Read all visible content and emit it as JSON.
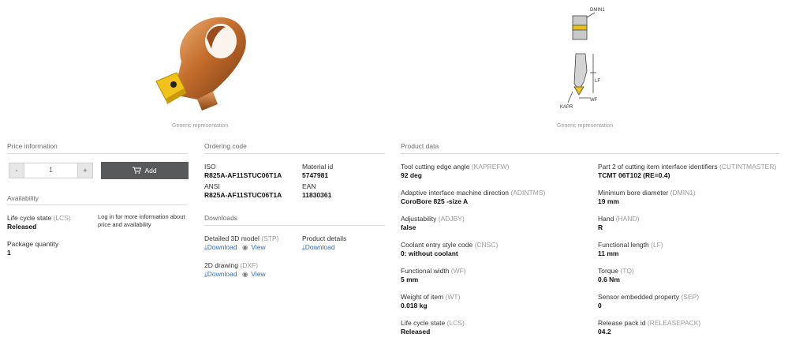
{
  "images": {
    "product_caption": "Generic representation",
    "drawing_caption": "Generic representation",
    "drawing_labels": {
      "dmin": "DMIN1",
      "lf": "LF",
      "wf": "WF",
      "kapr": "KAPR"
    }
  },
  "price": {
    "title": "Price information",
    "minus": "-",
    "quantity": "1",
    "plus": "+",
    "add_label": "Add"
  },
  "availability": {
    "title": "Availability",
    "lcs_label": "Life cycle state",
    "lcs_code": "(LCS)",
    "lcs_value": "Released",
    "login_note": "Log in for more information about price and availability",
    "pkg_label": "Package quantity",
    "pkg_value": "1"
  },
  "ordering": {
    "title": "Ordering code",
    "iso_label": "ISO",
    "iso_value": "R825A-AF11STUC06T1A",
    "ansi_label": "ANSI",
    "ansi_value": "R825A-AF11STUC06T1A",
    "material_label": "Material id",
    "material_value": "5747981",
    "ean_label": "EAN",
    "ean_value": "11830361"
  },
  "downloads": {
    "title": "Downloads",
    "model3d_label": "Detailed 3D model",
    "model3d_code": "(STP)",
    "drawing2d_label": "2D drawing",
    "drawing2d_code": "(DXF)",
    "product_details_label": "Product details",
    "download": "Download",
    "view": "View"
  },
  "product_data": {
    "title": "Product data",
    "left": [
      {
        "label": "Tool cutting edge angle",
        "code": "(KAPREFW)",
        "value": "92 deg"
      },
      {
        "label": "Adaptive interface machine direction",
        "code": "(ADINTMS)",
        "value": "CoroBore 825 -size A"
      },
      {
        "label": "Adjustability",
        "code": "(ADJBY)",
        "value": "false"
      },
      {
        "label": "Coolant entry style code",
        "code": "(CNSC)",
        "value": "0: without coolant"
      },
      {
        "label": "Functional width",
        "code": "(WF)",
        "value": "5 mm"
      },
      {
        "label": "Weight of item",
        "code": "(WT)",
        "value": "0.018 kg"
      },
      {
        "label": "Life cycle state",
        "code": "(LCS)",
        "value": "Released"
      }
    ],
    "right": [
      {
        "label": "Part 2 of cutting item interface identifiers",
        "code": "(CUTINTMASTER)",
        "value": "TCMT 06T102 (RE=0.4)"
      },
      {
        "label": "Minimum bore diameter",
        "code": "(DMIN1)",
        "value": "19 mm"
      },
      {
        "label": "Hand",
        "code": "(HAND)",
        "value": "R"
      },
      {
        "label": "Functional length",
        "code": "(LF)",
        "value": "11 mm"
      },
      {
        "label": "Torque",
        "code": "(TQ)",
        "value": "0.6 Nm"
      },
      {
        "label": "Sensor embedded property",
        "code": "(SEP)",
        "value": "0"
      },
      {
        "label": "Release pack id",
        "code": "(RELEASEPACK)",
        "value": "04.2"
      }
    ]
  }
}
